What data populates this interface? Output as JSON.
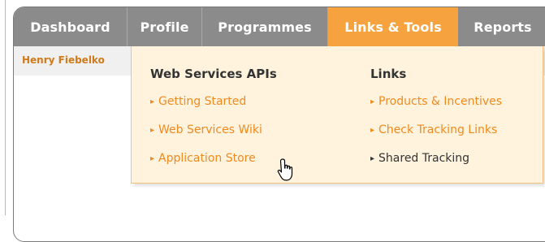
{
  "tabs": [
    {
      "label": "Dashboard"
    },
    {
      "label": "Profile"
    },
    {
      "label": "Programmes"
    },
    {
      "label": "Links & Tools"
    },
    {
      "label": "Reports"
    }
  ],
  "active_tab": "Links & Tools",
  "user": {
    "name": "Henry Fiebelko"
  },
  "dropdown": {
    "web_services": {
      "title": "Web Services APIs",
      "items": [
        "Getting Started",
        "Web Services Wiki",
        "Application Store"
      ]
    },
    "links": {
      "title": "Links",
      "items": [
        "Products & Incentives",
        "Check Tracking Links",
        "Shared Tracking"
      ]
    },
    "bullet_glyph": "▸"
  },
  "colors": {
    "tab_bar": "#8b8b8b",
    "active_tab": "#f5a23f",
    "dropdown_bg": "#fff3dd",
    "link": "#f08a1e",
    "hover_link": "#333333"
  },
  "cursor": {
    "icon": "hand-pointer-icon"
  }
}
